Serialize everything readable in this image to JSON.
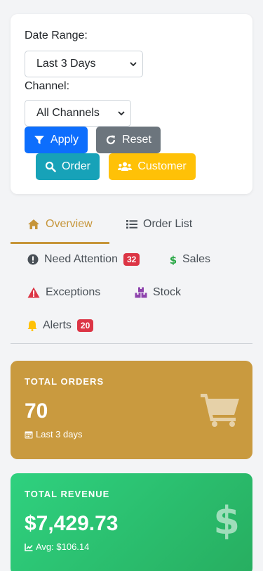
{
  "filters": {
    "date_range_label": "Date Range:",
    "date_range_value": "Last 3 Days",
    "channel_label": "Channel:",
    "channel_value": "All Channels",
    "buttons": {
      "apply": "Apply",
      "reset": "Reset",
      "order": "Order",
      "customer": "Customer"
    }
  },
  "tabs": {
    "overview": "Overview",
    "order_list": "Order List",
    "need_attention": "Need Attention",
    "need_attention_count": "32",
    "sales": "Sales",
    "exceptions": "Exceptions",
    "stock": "Stock",
    "alerts": "Alerts",
    "alerts_count": "20"
  },
  "stats": {
    "orders": {
      "title": "TOTAL ORDERS",
      "value": "70",
      "sub": "Last 3 days"
    },
    "revenue": {
      "title": "TOTAL REVENUE",
      "value": "$7,429.73",
      "sub": "Avg: $106.14"
    }
  },
  "colors": {
    "primary": "#0d6efd",
    "secondary": "#6c757d",
    "info": "#17a2b8",
    "warning": "#ffc107",
    "accent": "#c69539",
    "danger": "#dc3545",
    "success": "#2ecc71"
  }
}
